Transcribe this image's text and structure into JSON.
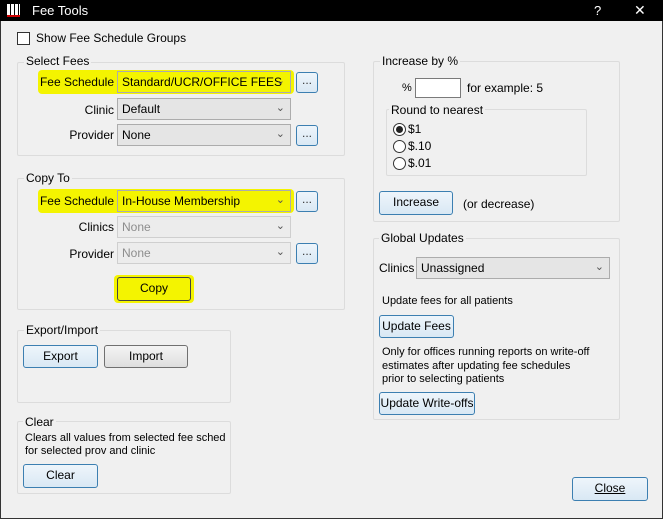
{
  "window": {
    "title": "Fee Tools",
    "help": "?",
    "close": "✕"
  },
  "show_groups": {
    "label": "Show Fee Schedule Groups",
    "checked": false
  },
  "select_fees": {
    "legend": "Select Fees",
    "fee_schedule_label": "Fee Schedule",
    "fee_schedule_value": "Standard/UCR/OFFICE FEES",
    "clinic_label": "Clinic",
    "clinic_value": "Default",
    "provider_label": "Provider",
    "provider_value": "None",
    "ellipsis": "..."
  },
  "copy_to": {
    "legend": "Copy To",
    "fee_schedule_label": "Fee Schedule",
    "fee_schedule_value": "In-House Membership",
    "clinics_label": "Clinics",
    "clinics_value": "None",
    "provider_label": "Provider",
    "provider_value": "None",
    "ellipsis": "...",
    "copy_button": "Copy"
  },
  "export_import": {
    "legend": "Export/Import",
    "export_button": "Export",
    "import_button": "Import"
  },
  "clear": {
    "legend": "Clear",
    "description_1": "Clears all values from selected fee sched",
    "description_2": "for selected prov and clinic",
    "clear_button": "Clear"
  },
  "increase": {
    "legend": "Increase by %",
    "percent_label": "%",
    "percent_value": "",
    "example": "for example: 5",
    "round_legend": "Round to nearest",
    "round_options": [
      {
        "label": "$1",
        "selected": true
      },
      {
        "label": "$.10",
        "selected": false
      },
      {
        "label": "$.01",
        "selected": false
      }
    ],
    "increase_button": "Increase",
    "or_decrease": "(or decrease)"
  },
  "global_updates": {
    "legend": "Global Updates",
    "clinics_label": "Clinics",
    "clinics_value": "Unassigned",
    "update_fees_text": "Update fees for all patients",
    "update_fees_button": "Update Fees",
    "writeoff_text_1": "Only for offices running reports on write-off",
    "writeoff_text_2": "estimates after updating fee schedules",
    "writeoff_text_3": "prior to selecting patients",
    "update_writeoffs_button": "Update Write-offs"
  },
  "close_button": "Close",
  "colors": {
    "highlight": "#f4f400",
    "titlebar": "#000000"
  }
}
